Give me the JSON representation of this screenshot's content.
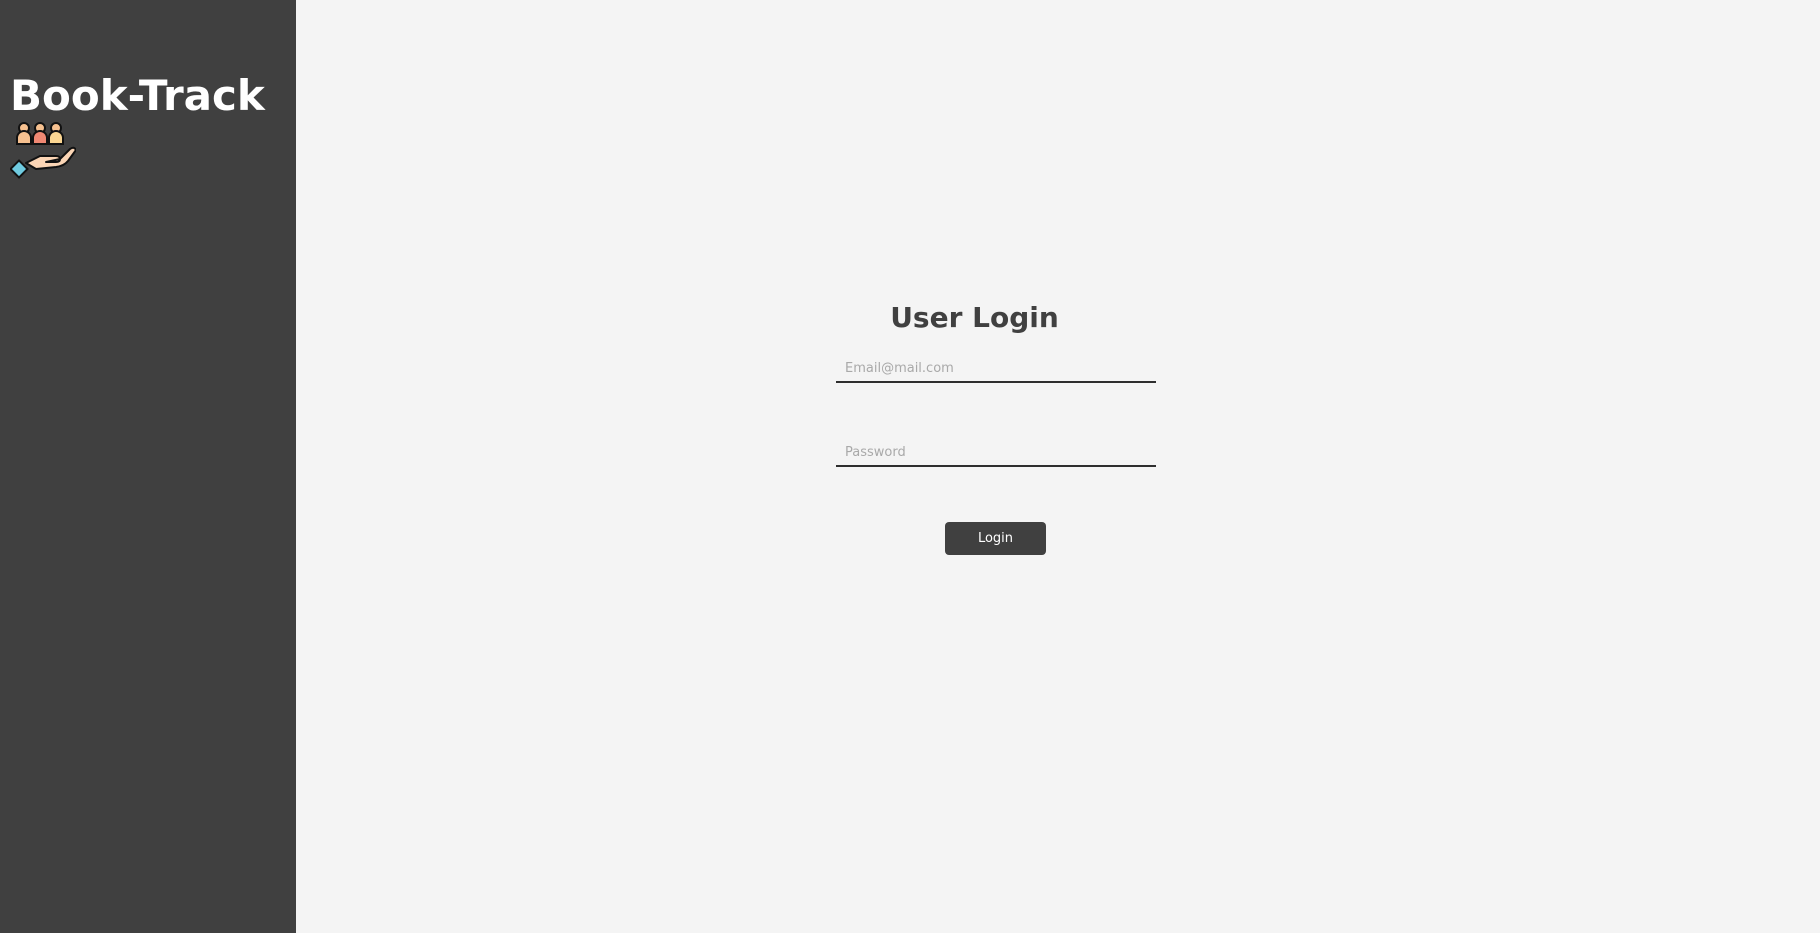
{
  "sidebar": {
    "brand_title": "Book-Track",
    "logo_icon": "people-in-hand-icon",
    "background_color": "#404040"
  },
  "login": {
    "title": "User Login",
    "email_placeholder": "Email@mail.com",
    "email_value": "",
    "password_placeholder": "Password",
    "password_value": "",
    "button_label": "Login",
    "accent_color": "#404040"
  },
  "main": {
    "background_color": "#f4f4f4"
  }
}
